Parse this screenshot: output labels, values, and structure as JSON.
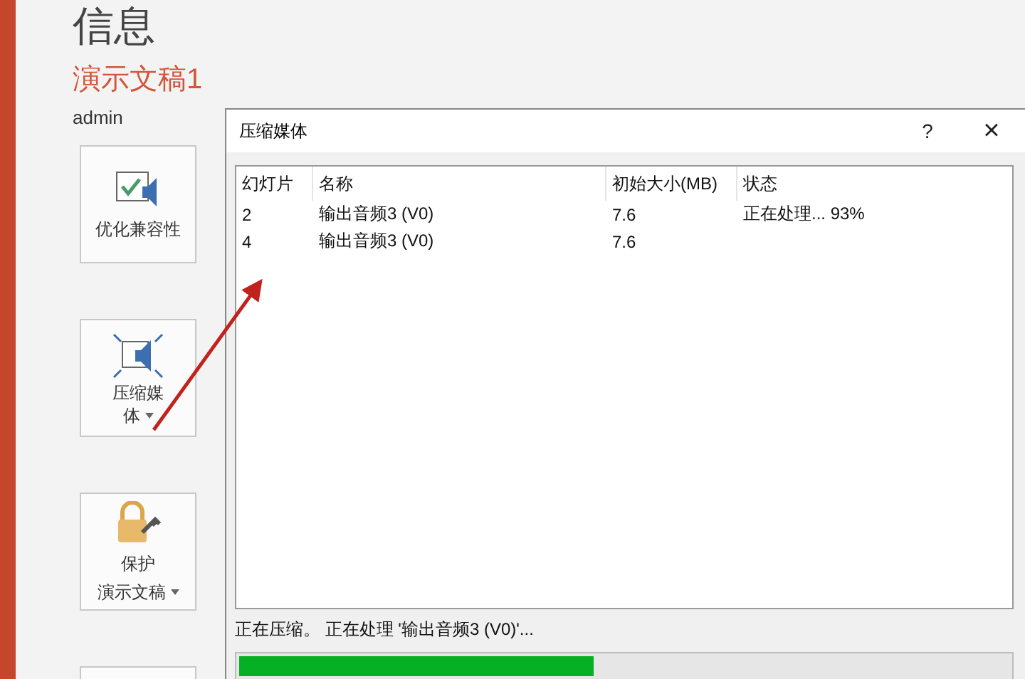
{
  "page": {
    "title": "信息",
    "document": "演示文稿1",
    "author": "admin",
    "actions": [
      {
        "lines": [
          "优化兼容性"
        ],
        "kind": "compat"
      },
      {
        "lines": [
          "压缩媒",
          "体"
        ],
        "kind": "compress",
        "dropdown": true
      },
      {
        "lines": [
          "保护",
          "演示文稿"
        ],
        "kind": "protect",
        "dropdown": true
      },
      {
        "kind": "blank"
      }
    ]
  },
  "dialog": {
    "title": "压缩媒体",
    "help": "?",
    "close": "×",
    "table": {
      "columns": [
        "幻灯片",
        "名称",
        "初始大小(MB)",
        "状态"
      ],
      "rows": [
        [
          "2",
          "输出音频3 (V0)",
          "7.6",
          "正在处理... 93%"
        ],
        [
          "4",
          "输出音频3 (V0)",
          "7.6",
          ""
        ]
      ]
    },
    "status": "正在压缩。 正在处理 '输出音频3 (V0)'...",
    "progress": {
      "level": 0.46
    }
  }
}
